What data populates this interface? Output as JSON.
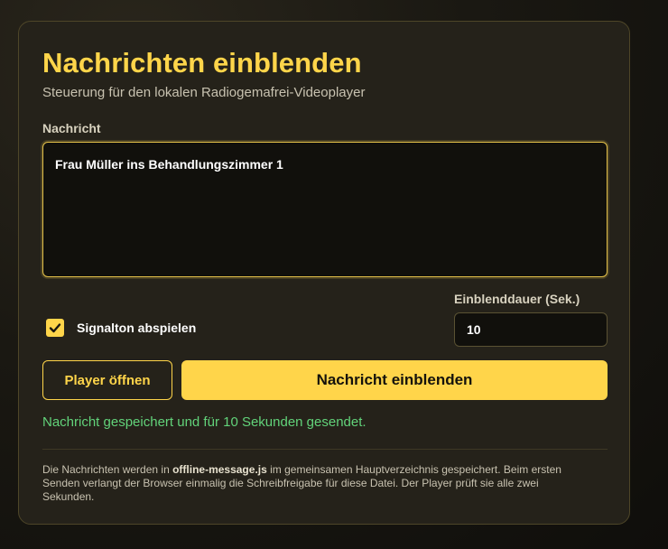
{
  "card": {
    "title": "Nachrichten einblenden",
    "subtitle": "Steuerung für den lokalen Radiogemafrei-Videoplayer"
  },
  "message": {
    "label": "Nachricht",
    "value": "Frau Müller ins Behandlungszimmer 1"
  },
  "signal": {
    "label": "Signalton abspielen",
    "checked": true
  },
  "duration": {
    "label": "Einblenddauer (Sek.)",
    "value": "10"
  },
  "buttons": {
    "open_player": "Player öffnen",
    "send": "Nachricht einblenden"
  },
  "status": {
    "text": "Nachricht gespeichert und für 10 Sekunden gesendet."
  },
  "footnote": {
    "part1": "Die Nachrichten werden in ",
    "file": "offline-message.js",
    "part2": " im gemeinsamen Hauptverzeichnis gespeichert. Beim ersten Senden verlangt der Browser einmalig die Schreibfreigabe für diese Datei. Der Player prüft sie alle zwei Sekunden."
  },
  "colors": {
    "accent": "#ffd54a",
    "success": "#62d37a",
    "card_bg": "#25221a"
  }
}
